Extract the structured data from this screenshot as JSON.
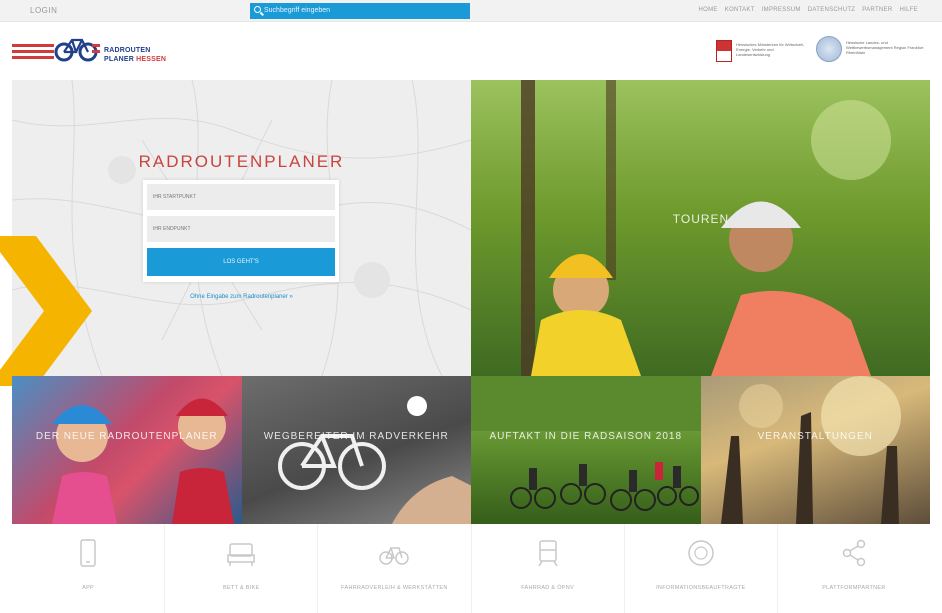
{
  "topbar": {
    "login_label": "LOGIN",
    "search_placeholder": "Suchbegriff eingeben",
    "nav": [
      "HOME",
      "KONTAKT",
      "IMPRESSUM",
      "DATENSCHUTZ",
      "PARTNER",
      "HILFE"
    ]
  },
  "header": {
    "logo_line1": "RADROUTEN",
    "logo_line2a": "PLANER",
    "logo_line2b": "HESSEN",
    "partner1_text": "Hessisches Ministerium für Wirtschaft, Energie, Verkehr und Landesentwicklung",
    "partner2_text": "Hessische Landes- und Wettbewerbsmanagement Region Frankfurt RheinMain"
  },
  "planner": {
    "title": "RADROUTENPLANER",
    "start_placeholder": "IHR STARTPUNKT",
    "end_placeholder": "IHR ENDPUNKT",
    "go_label": "LOS GEHT'S",
    "link_label": "Ohne Eingabe zum Radroutenplaner »"
  },
  "hero_photo": {
    "label": "TOUREN"
  },
  "tiles": [
    {
      "label": "DER NEUE RADROUTENPLANER"
    },
    {
      "label": "WEGBEREITER IM RADVERKEHR"
    },
    {
      "label": "AUFTAKT IN DIE RADSAISON 2018"
    },
    {
      "label": "VERANSTALTUNGEN"
    }
  ],
  "bottom_icons": [
    {
      "icon": "phone-icon",
      "label": "APP"
    },
    {
      "icon": "bed-icon",
      "label": "BETT & BIKE"
    },
    {
      "icon": "bike-icon",
      "label": "FAHRRADVERLEIH & WERKSTÄTTEN"
    },
    {
      "icon": "train-icon",
      "label": "FAHRRAD & ÖPNV"
    },
    {
      "icon": "info-icon",
      "label": "INFORMATIONSBEAUFTRAGTE"
    },
    {
      "icon": "share-icon",
      "label": "PLATTFORMPARTNER"
    }
  ],
  "colors": {
    "accent_blue": "#1a9ad6",
    "title_red": "#c9443f",
    "arrow_yellow": "#f5b400",
    "logo_navy": "#20408a"
  }
}
